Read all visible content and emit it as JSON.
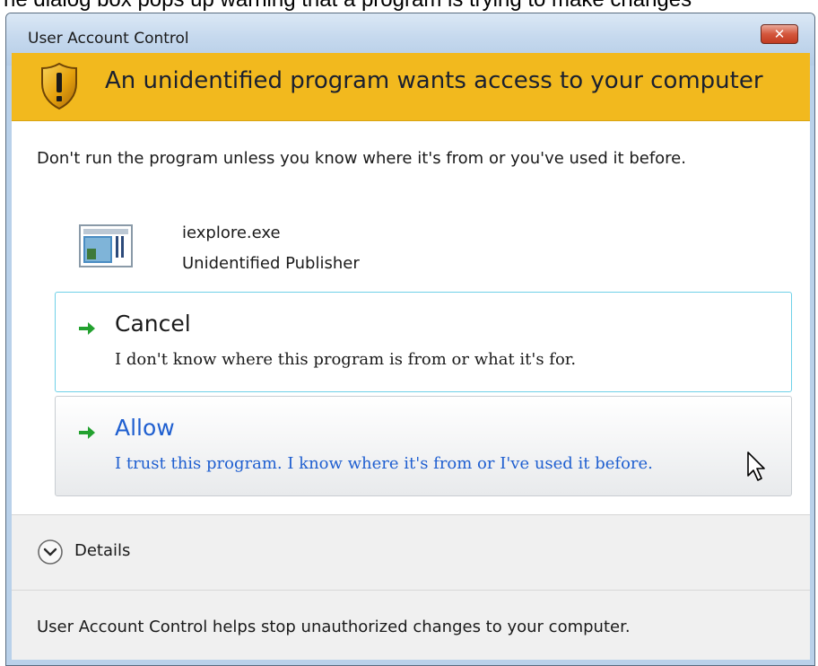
{
  "caption_fragment": "he dialog box pops up warning that a program is trying to make changes",
  "window": {
    "title": "User Account Control",
    "close_glyph": "✕"
  },
  "header": {
    "title": "An unidentified program wants access to your computer",
    "icon": "shield-warning-icon",
    "color": "#f2b91e"
  },
  "body": {
    "warning": "Don't run the program unless you know where it's from or you've used it before.",
    "program": {
      "icon": "program-icon",
      "name": "iexplore.exe",
      "publisher": "Unidentified Publisher"
    }
  },
  "actions": {
    "cancel": {
      "title": "Cancel",
      "subtitle": "I don't know where this program is from or what it's for."
    },
    "allow": {
      "title": "Allow",
      "subtitle": "I trust this program. I know where it's from or I've used it before.",
      "color": "#1f5fd0"
    }
  },
  "details": {
    "label": "Details"
  },
  "footer": {
    "text": "User Account Control helps stop unauthorized changes to your computer."
  }
}
